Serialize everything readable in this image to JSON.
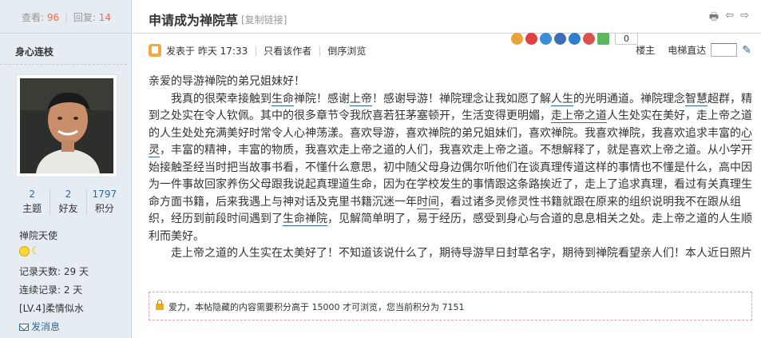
{
  "stats": {
    "views_label": "查看:",
    "views": "96",
    "replies_label": "回复:",
    "replies": "14"
  },
  "author": {
    "name": "身心连枝"
  },
  "profile": {
    "counts": [
      {
        "value": "2",
        "label": "主题"
      },
      {
        "value": "2",
        "label": "好友"
      },
      {
        "value": "1797",
        "label": "积分"
      }
    ],
    "rank": "禅院天使",
    "record_days": "记录天数: 29 天",
    "streak": "连续记录: 2 天",
    "level": "[LV.4]柔情似水",
    "message_label": "发消息"
  },
  "thread": {
    "title": "申请成为禅院草",
    "copy_link": "[复制链接]",
    "share_count": "0"
  },
  "post_meta": {
    "posted": "发表于 昨天 17:33",
    "only_author": "只看该作者",
    "reverse": "倒序浏览",
    "floor": "楼主",
    "elevator": "电梯直达"
  },
  "content": {
    "greeting": "亲爱的导游禅院的弟兄姐妹好！",
    "para1_a": "我真的很荣幸接触到",
    "kw1": "生命",
    "para1_b": "禅院！感谢",
    "kw2": "上帝",
    "para1_c": "！感谢导游！禅院理念让我如愿了解",
    "kw3": "人生",
    "para1_d": "的光明通道。禅院理念",
    "kw4": "智慧",
    "para1_e": "超群，精到之处实在令人钦佩。其中的很多章节令我欣喜若狂茅塞顿开，生活变得更明媚，",
    "kw5": "走上帝之道",
    "para1_f": "人生处实在美好，走上帝之道的人生处处充满美好时常令人心神荡漾。喜欢导游，喜欢禅院的弟兄姐妹们，喜欢禅院。我喜欢禅院，我喜欢追求丰富的",
    "kw6": "心灵",
    "para1_g": "，丰富的精神，丰富的物质，我喜欢走上帝之道的人们，我喜欢走上帝之道。不想解释了，就是喜欢上帝之道。从小学开始接触圣经当时把当故事书看，不懂什么意思，初中随父母身边偶尔听他们在谈真理传道这样的事情也不懂是什么，高中因为一件事故回家养伤父母跟我说起真理道生命，因为在学校发生的事情跟这条路挨近了，走上了追求真理，看过有关真理生命方面书籍，后来我遇上与神对话及克里书籍沉迷一年",
    "kw7": "时间",
    "para1_h": "，看过诸多灵修灵性书籍就跟在原来的组织说明我不在跟从组织，经历到前段时间遇到了",
    "kw8": "生命禅院",
    "para1_i": "，见解简单明了，易于经历，感受到身心与合道的息息相关之处。走上帝之道的人生顺利而美好。",
    "para2": "走上帝之道的人生实在太美好了！不知道该说什么了，期待导游早日封草名字，期待到禅院看望亲人们！本人近日照片"
  },
  "locked": {
    "text": "爱力，本帖隐藏的内容需要积分高于 15000 才可浏览，您当前积分为 7151"
  },
  "colors": {
    "accent": "#336699",
    "number": "#f26c4f",
    "sidebar_bg": "#e5edf2"
  }
}
